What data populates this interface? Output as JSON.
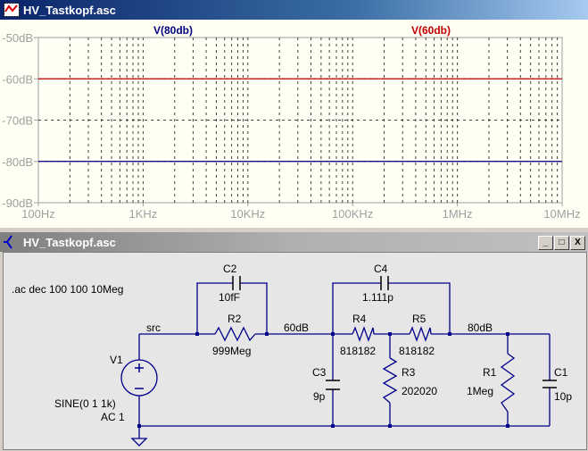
{
  "plot_window": {
    "title": "HV_Tastkopf.asc"
  },
  "schematic_window": {
    "title": "HV_Tastkopf.asc",
    "min": "_",
    "max": "□",
    "close": "X"
  },
  "chart_data": {
    "type": "line",
    "xscale": "log",
    "xlim": [
      100,
      10000000
    ],
    "ylim": [
      -90,
      -50
    ],
    "x_ticks": [
      "100Hz",
      "1KHz",
      "10KHz",
      "100KHz",
      "1MHz",
      "10MHz"
    ],
    "y_ticks": [
      "-50dB",
      "-60dB",
      "-70dB",
      "-80dB",
      "-90dB"
    ],
    "series": [
      {
        "name": "V(80db)",
        "color": "#000080",
        "value_db": -80
      },
      {
        "name": "V(60db)",
        "color": "#c00000",
        "value_db": -60
      }
    ],
    "grid": true
  },
  "schematic": {
    "directive": ".ac dec 100 100 10Meg",
    "nets": {
      "src": "src",
      "n60": "60dB",
      "n80": "80dB"
    },
    "V1": {
      "name": "V1",
      "value": "SINE(0 1 1k)",
      "ac": "AC 1"
    },
    "C2": {
      "name": "C2",
      "value": "10fF"
    },
    "R2": {
      "name": "R2",
      "value": "999Meg"
    },
    "C4": {
      "name": "C4",
      "value": "1.111p"
    },
    "R4": {
      "name": "R4",
      "value": "818182"
    },
    "R5": {
      "name": "R5",
      "value": "818182"
    },
    "C3": {
      "name": "C3",
      "value": "9p"
    },
    "R3": {
      "name": "R3",
      "value": "202020"
    },
    "R1": {
      "name": "R1",
      "value": "1Meg"
    },
    "C1": {
      "name": "C1",
      "value": "10p"
    }
  }
}
